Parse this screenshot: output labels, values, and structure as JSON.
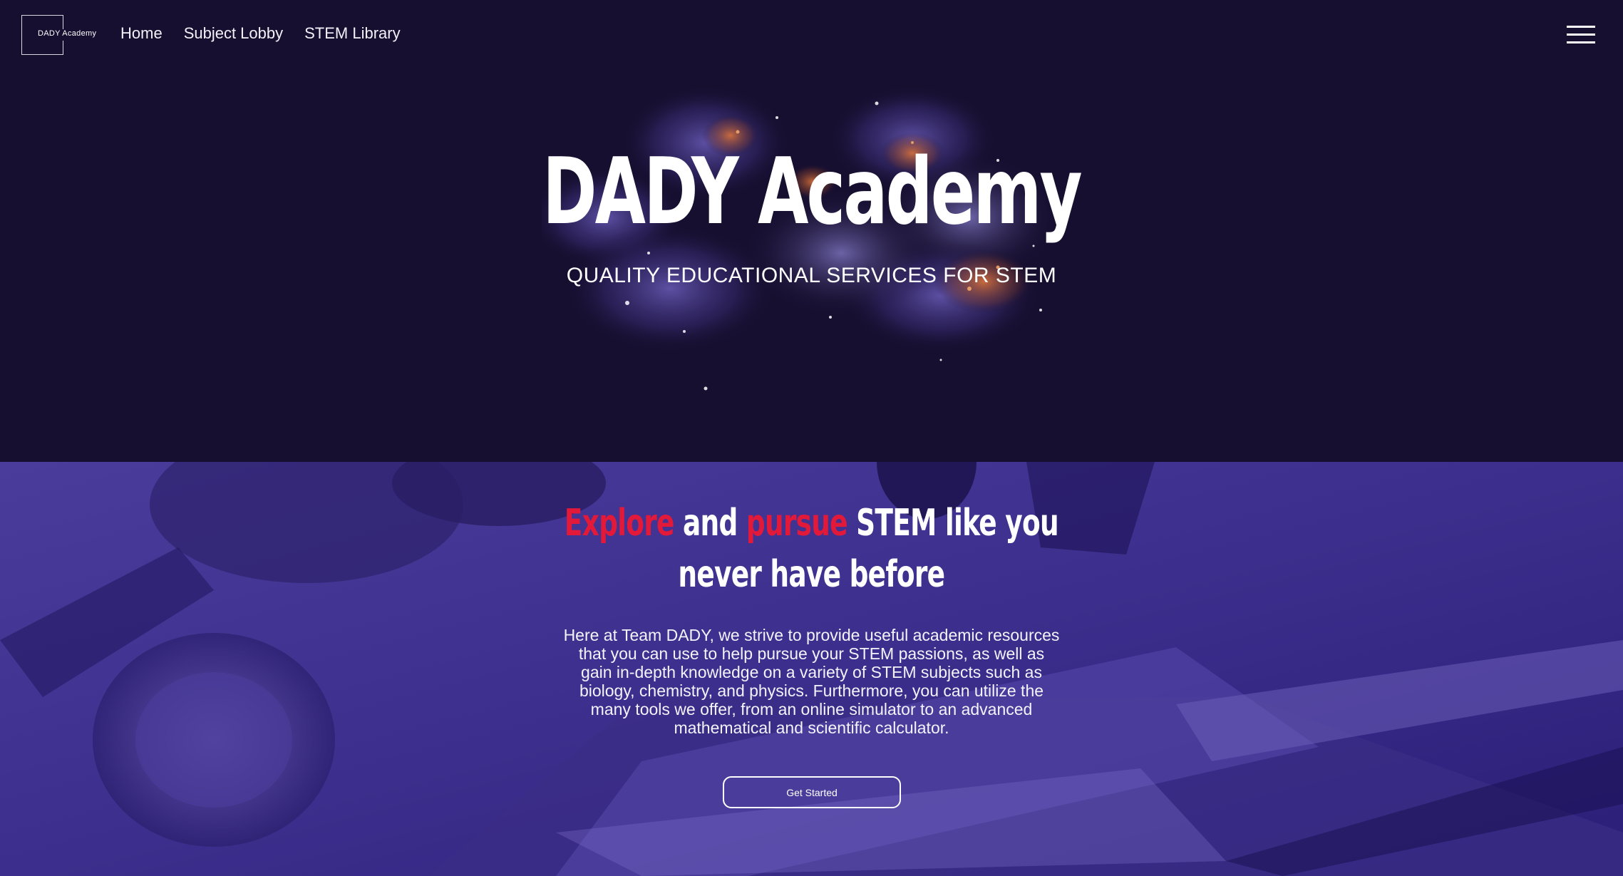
{
  "brand": {
    "logo_text": "DADY Academy"
  },
  "nav": {
    "links": [
      "Home",
      "Subject Lobby",
      "STEM Library"
    ],
    "menu_icon": "hamburger-menu-icon"
  },
  "hero": {
    "title": "DADY Academy",
    "subtitle": "QUALITY EDUCATIONAL SERVICES FOR STEM",
    "background": "nebula-image"
  },
  "about": {
    "heading_parts": [
      {
        "text": "Explore",
        "color": "#e3193a"
      },
      {
        "text": " and ",
        "color": "#ffffff"
      },
      {
        "text": "pursue",
        "color": "#e3193a"
      },
      {
        "text": " STEM like you",
        "color": "#ffffff"
      }
    ],
    "heading_line2": "never have before",
    "body": "Here at Team DADY, we strive to provide useful academic resources that you can use to help pursue your STEM passions, as well as gain in-depth knowledge on a variety of STEM subjects such as biology, chemistry, and physics. Furthermore, you can utilize the many tools we offer, from an online simulator to an advanced mathematical and scientific calculator.",
    "cta_label": "Get Started",
    "background": "microscope-image"
  },
  "colors": {
    "page_bg": "#170f30",
    "accent_red": "#e3193a",
    "section_purple": "#3a2c8c"
  }
}
